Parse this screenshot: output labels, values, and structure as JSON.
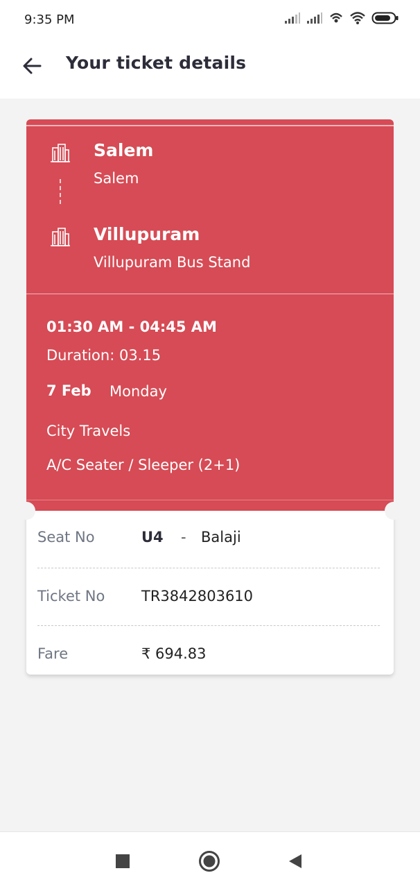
{
  "status": {
    "time": "9:35 PM"
  },
  "header": {
    "title": "Your ticket details"
  },
  "route": {
    "from_city": "Salem",
    "from_point": "Salem",
    "to_city": "Villupuram",
    "to_point": "Villupuram Bus Stand"
  },
  "trip": {
    "time_range": "01:30 AM - 04:45 AM",
    "duration": "Duration: 03.15",
    "date": "7 Feb",
    "day": "Monday",
    "operator": "City Travels",
    "bus_type": "A/C Seater / Sleeper (2+1)"
  },
  "details": {
    "seat_label": "Seat No",
    "seat_value": "U4",
    "seat_sep": "-",
    "passenger": "Balaji",
    "ticket_label": "Ticket No",
    "ticket_value": "TR3842803610",
    "fare_label": "Fare",
    "fare_value": "₹ 694.83"
  },
  "colors": {
    "ticket_red": "#d64b55",
    "background": "#f3f3f3"
  }
}
